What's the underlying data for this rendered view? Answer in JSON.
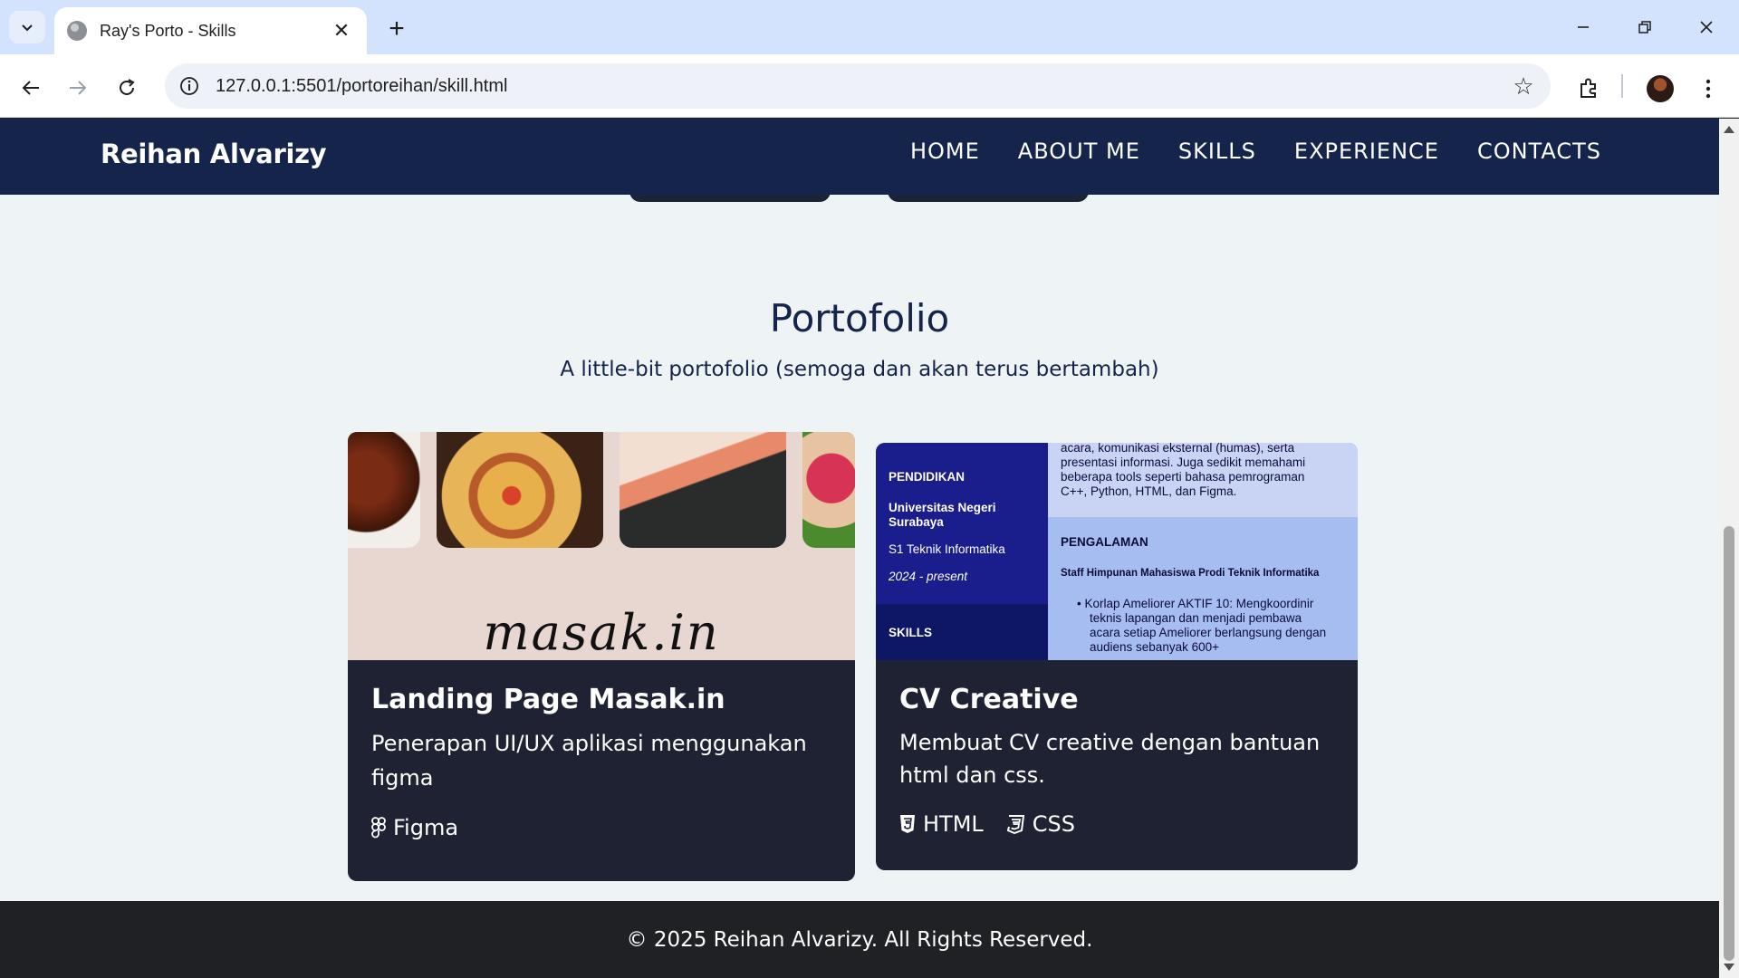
{
  "browser": {
    "tab_title": "Ray's Porto - Skills",
    "url": "127.0.0.1:5501/portoreihan/skill.html"
  },
  "site": {
    "brand": "Reihan Alvarizy",
    "nav": [
      "HOME",
      "ABOUT ME",
      "SKILLS",
      "EXPERIENCE",
      "CONTACTS"
    ]
  },
  "portfolio": {
    "title": "Portofolio",
    "subtitle": "A little-bit portofolio (semoga dan akan terus bertambah)",
    "cards": [
      {
        "thumb_text": "masak.in",
        "title": "Landing Page Masak.in",
        "description": "Penerapan UI/UX aplikasi menggunakan figma",
        "tags": [
          {
            "icon": "figma-icon",
            "label": "Figma"
          }
        ]
      },
      {
        "title": "CV Creative",
        "description": "Membuat CV creative dengan bantuan html dan css.",
        "tags": [
          {
            "icon": "html5-icon",
            "label": "HTML"
          },
          {
            "icon": "css3-icon",
            "label": "CSS"
          }
        ],
        "cv_preview": {
          "intro_lines": [
            "acara, komunikasi eksternal (humas), serta",
            "presentasi informasi. Juga sedikit memahami",
            "beberapa tools seperti bahasa pemrograman",
            "C++, Python, HTML, dan Figma."
          ],
          "pendidikan_heading": "PENDIDIKAN",
          "university_line1": "Universitas Negeri",
          "university_line2": "Surabaya",
          "degree": "S1 Teknik Informatika",
          "period": "2024 - present",
          "skills_heading": "SKILLS",
          "pengalaman_heading": "PENGALAMAN",
          "role": "Staff Himpunan Mahasiswa Prodi Teknik Informatika",
          "bullet_lines": [
            "Korlap Ameliorer AKTIF 10: Mengkoordinir",
            "teknis lapangan dan menjadi pembawa",
            "acara setiap Ameliorer berlangsung dengan",
            "audiens sebanyak 600+"
          ]
        }
      }
    ]
  },
  "footer": {
    "text": "© 2025 Reihan Alvarizy. All Rights Reserved."
  },
  "colors": {
    "header_bg": "#14244a",
    "card_bg": "#1e2233",
    "page_bg": "#eef3f6",
    "footer_bg": "#1f2125"
  }
}
